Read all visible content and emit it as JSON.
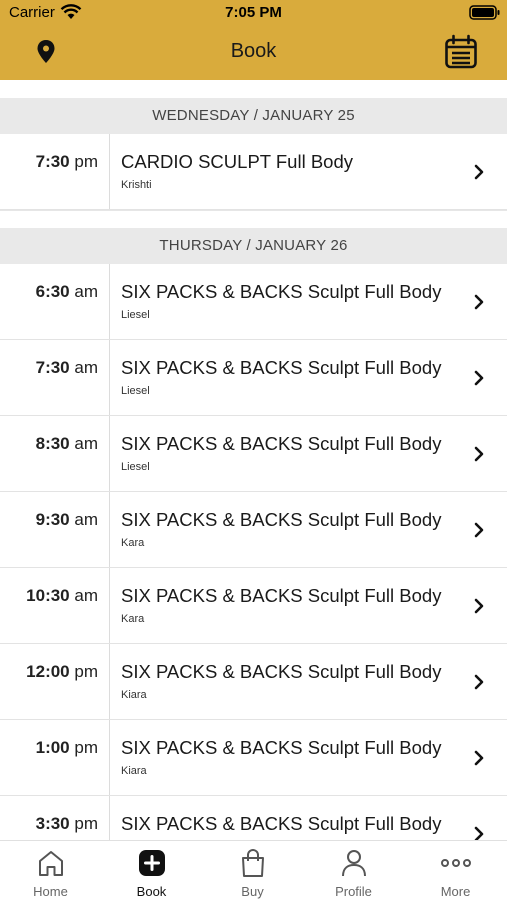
{
  "status_bar": {
    "carrier": "Carrier",
    "time": "7:05 PM"
  },
  "nav": {
    "title": "Book",
    "left_icon": "location-pin-icon",
    "right_icon": "calendar-icon"
  },
  "colors": {
    "header": "#d9ab3c",
    "section_bg": "#e9e9e9"
  },
  "days": [
    {
      "label": "WEDNESDAY / JANUARY 25",
      "classes": [
        {
          "time": "7:30",
          "ampm": "pm",
          "title": "CARDIO SCULPT Full Body",
          "instructor": "Krishti"
        }
      ]
    },
    {
      "label": "THURSDAY / JANUARY 26",
      "classes": [
        {
          "time": "6:30",
          "ampm": "am",
          "title": "SIX PACKS & BACKS Sculpt Full Body",
          "instructor": "Liesel"
        },
        {
          "time": "7:30",
          "ampm": "am",
          "title": "SIX PACKS & BACKS Sculpt Full Body",
          "instructor": "Liesel"
        },
        {
          "time": "8:30",
          "ampm": "am",
          "title": "SIX PACKS & BACKS Sculpt Full Body",
          "instructor": "Liesel"
        },
        {
          "time": "9:30",
          "ampm": "am",
          "title": "SIX PACKS & BACKS Sculpt Full Body",
          "instructor": "Kara"
        },
        {
          "time": "10:30",
          "ampm": "am",
          "title": "SIX PACKS & BACKS Sculpt Full Body",
          "instructor": "Kara"
        },
        {
          "time": "12:00",
          "ampm": "pm",
          "title": "SIX PACKS & BACKS Sculpt Full Body",
          "instructor": "Kiara"
        },
        {
          "time": "1:00",
          "ampm": "pm",
          "title": "SIX PACKS & BACKS Sculpt Full Body",
          "instructor": "Kiara"
        },
        {
          "time": "3:30",
          "ampm": "pm",
          "title": "SIX PACKS & BACKS Sculpt Full Body",
          "instructor": ""
        }
      ]
    }
  ],
  "tabs": [
    {
      "label": "Home",
      "icon": "home-icon",
      "active": false
    },
    {
      "label": "Book",
      "icon": "book-plus-icon",
      "active": true
    },
    {
      "label": "Buy",
      "icon": "shopping-bag-icon",
      "active": false
    },
    {
      "label": "Profile",
      "icon": "profile-icon",
      "active": false
    },
    {
      "label": "More",
      "icon": "more-dots-icon",
      "active": false
    }
  ]
}
